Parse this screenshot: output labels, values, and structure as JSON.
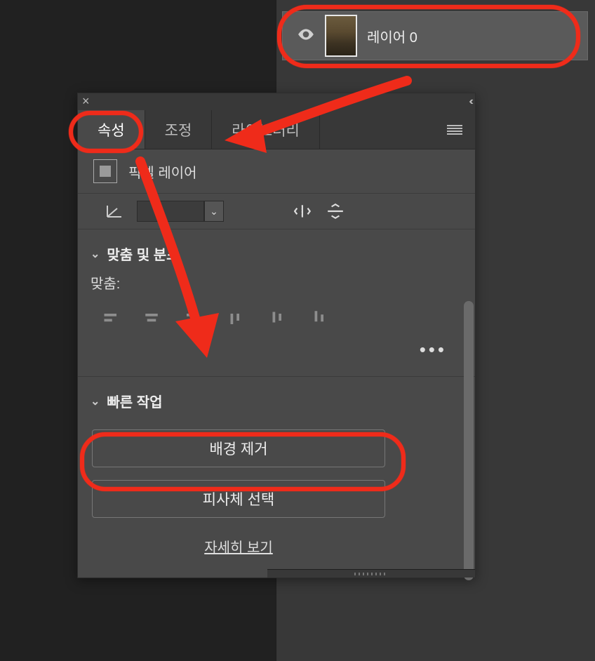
{
  "layers": {
    "selected": {
      "name": "레이어 0"
    }
  },
  "panel": {
    "tabs": {
      "properties": "속성",
      "adjustments": "조정",
      "libraries": "라이브러리"
    },
    "close_glyph": "×",
    "collapse_glyph": "‹‹"
  },
  "pixel_layer_label": "픽셀 레이어",
  "sections": {
    "align_title": "맞춤 및 분포",
    "align_label": "맞춤:",
    "more_glyph": "•••",
    "quick_actions_title": "빠른 작업"
  },
  "quick_actions": {
    "remove_bg": "배경 제거",
    "select_subject": "피사체 선택",
    "learn_more": "자세히 보기"
  },
  "transform": {
    "angle_value": ""
  }
}
